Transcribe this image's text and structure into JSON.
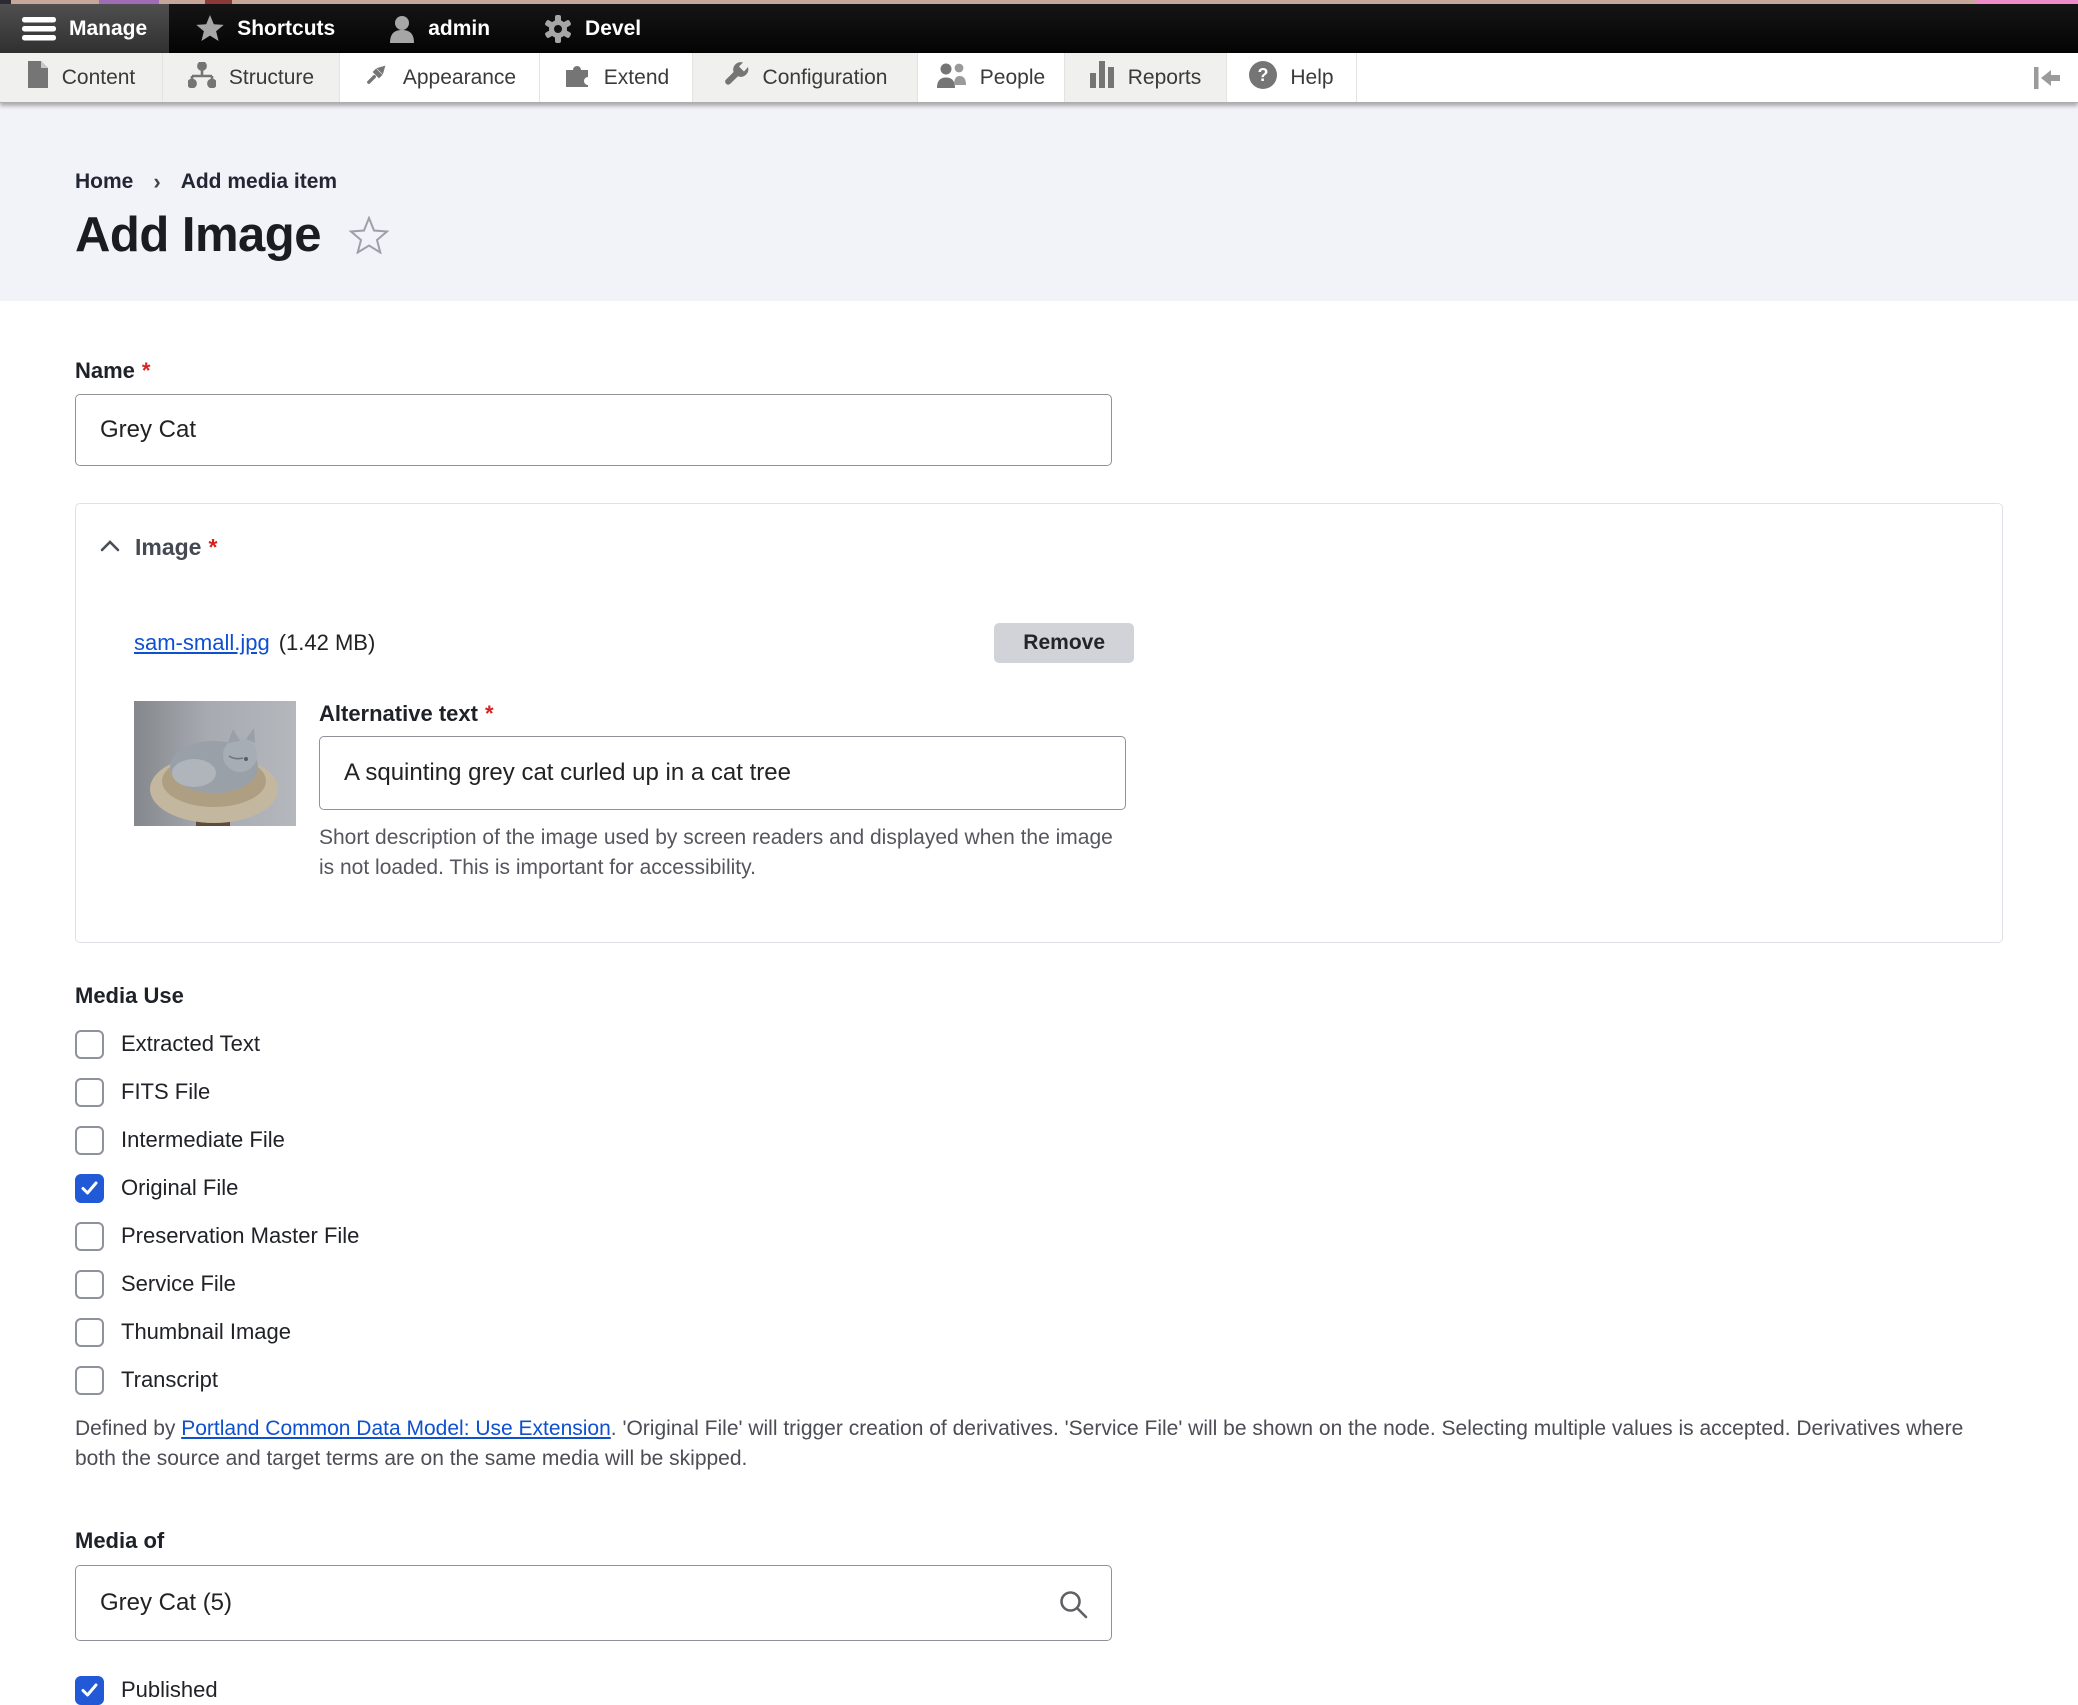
{
  "admin_toolbar": {
    "items": [
      {
        "label": "Manage",
        "icon": "hamburger-icon",
        "active": true
      },
      {
        "label": "Shortcuts",
        "icon": "star-icon",
        "active": false
      },
      {
        "label": "admin",
        "icon": "user-icon",
        "active": false
      },
      {
        "label": "Devel",
        "icon": "gear-icon",
        "active": false
      }
    ]
  },
  "menu_bar": {
    "items": [
      {
        "label": "Content",
        "icon": "document-icon"
      },
      {
        "label": "Structure",
        "icon": "sitemap-icon"
      },
      {
        "label": "Appearance",
        "icon": "brush-icon"
      },
      {
        "label": "Extend",
        "icon": "puzzle-icon"
      },
      {
        "label": "Configuration",
        "icon": "wrench-icon"
      },
      {
        "label": "People",
        "icon": "people-icon"
      },
      {
        "label": "Reports",
        "icon": "bar-chart-icon"
      },
      {
        "label": "Help",
        "icon": "help-icon"
      }
    ],
    "collapse_icon": "toolbar-collapse-icon"
  },
  "breadcrumb": {
    "home": "Home",
    "separator": "›",
    "current": "Add media item"
  },
  "page": {
    "title": "Add Image",
    "favorite_icon": "star-outline-icon"
  },
  "form": {
    "name_field": {
      "label": "Name",
      "required": true,
      "value": "Grey Cat"
    },
    "image_fieldset": {
      "legend": "Image",
      "required": true,
      "collapse_icon": "chevron-up-icon",
      "file_name": "sam-small.jpg",
      "file_size": "(1.42 MB)",
      "remove_label": "Remove",
      "thumbnail": "grey cat curled up in a tan cat-tree bed",
      "alt_field": {
        "label": "Alternative text",
        "required": true,
        "value": "A squinting grey cat curled up in a cat tree",
        "description": "Short description of the image used by screen readers and displayed when the image is not loaded. This is important for accessibility."
      }
    },
    "media_use": {
      "label": "Media Use",
      "options": [
        {
          "label": "Extracted Text",
          "checked": false
        },
        {
          "label": "FITS File",
          "checked": false
        },
        {
          "label": "Intermediate File",
          "checked": false
        },
        {
          "label": "Original File",
          "checked": true
        },
        {
          "label": "Preservation Master File",
          "checked": false
        },
        {
          "label": "Service File",
          "checked": false
        },
        {
          "label": "Thumbnail Image",
          "checked": false
        },
        {
          "label": "Transcript",
          "checked": false
        }
      ],
      "description_prefix": "Defined by ",
      "description_link": "Portland Common Data Model: Use Extension",
      "description_suffix": ". 'Original File' will trigger creation of derivatives. 'Service File' will be shown on the node. Selecting multiple values is accepted. Derivatives where both the source and target terms are on the same media will be skipped."
    },
    "media_of": {
      "label": "Media of",
      "value": "Grey Cat (5)",
      "icon": "search-icon"
    },
    "published": {
      "label": "Published",
      "checked": true
    }
  },
  "colors": {
    "accent_blue": "#2159d6",
    "link_blue": "#0f50d0",
    "required_red": "#d72222"
  }
}
